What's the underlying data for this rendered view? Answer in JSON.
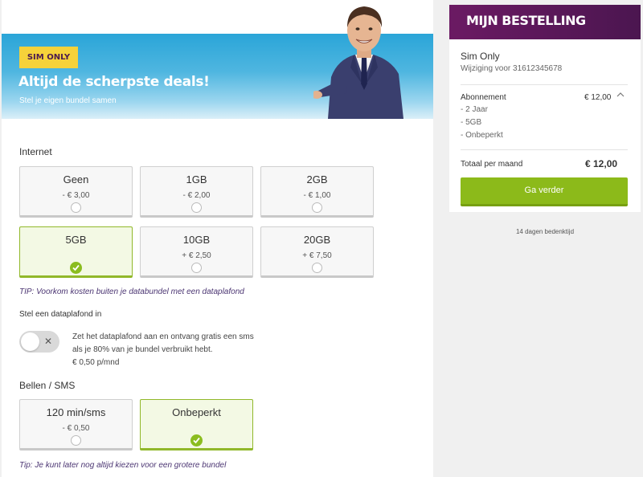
{
  "hero": {
    "badge": "SIM ONLY",
    "title": "Altijd de scherpste deals!",
    "subtitle": "Stel je eigen bundel samen"
  },
  "internet": {
    "label": "Internet",
    "options": [
      {
        "title": "Geen",
        "price": "- € 3,00",
        "selected": false
      },
      {
        "title": "1GB",
        "price": "- € 2,00",
        "selected": false
      },
      {
        "title": "2GB",
        "price": "- € 1,00",
        "selected": false
      },
      {
        "title": "5GB",
        "price": "",
        "selected": true
      },
      {
        "title": "10GB",
        "price": "+ € 2,50",
        "selected": false
      },
      {
        "title": "20GB",
        "price": "+ € 7,50",
        "selected": false
      }
    ],
    "tip": "TIP: Voorkom kosten buiten je databundel met een dataplafond"
  },
  "dataplafond": {
    "label": "Stel een dataplafond in",
    "toggle_symbol": "✕",
    "line1": "Zet het dataplafond aan en ontvang gratis een sms",
    "line2": "als je 80% van je bundel verbruikt hebt.",
    "line3": "€ 0,50 p/mnd"
  },
  "bellen": {
    "label": "Bellen / SMS",
    "options": [
      {
        "title": "120 min/sms",
        "price": "- € 0,50",
        "selected": false
      },
      {
        "title": "Onbeperkt",
        "price": "",
        "selected": true
      }
    ],
    "tip": "Tip: Je kunt later nog altijd kiezen voor een grotere bundel"
  },
  "order": {
    "title": "MIJN BESTELLING",
    "product": "Sim Only",
    "change": "Wijziging voor 31612345678",
    "subscription_label": "Abonnement",
    "subscription_price": "€ 12,00",
    "items": [
      "- 2 Jaar",
      "- 5GB",
      "- Onbeperkt"
    ],
    "total_label": "Totaal per maand",
    "total_price": "€ 12,00",
    "button": "Ga verder",
    "note": "14 dagen bedenktijd"
  },
  "colors": {
    "accent_green": "#8cba1a",
    "brand_purple": "#5c1a5a",
    "badge_yellow": "#f6d23a",
    "hero_blue": "#2aa5d8"
  }
}
